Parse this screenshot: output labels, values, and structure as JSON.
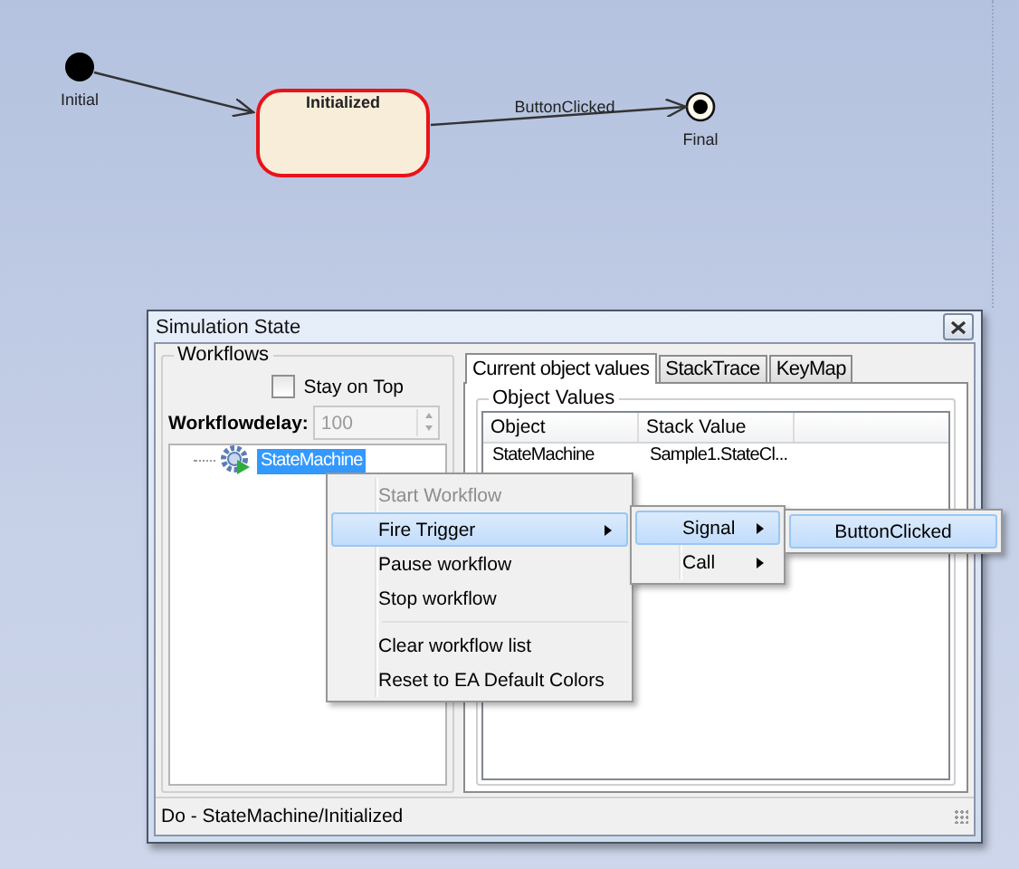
{
  "diagram": {
    "nodes": [
      {
        "kind": "initial",
        "label": "Initial"
      },
      {
        "kind": "state",
        "label": "Initialized",
        "current": true
      },
      {
        "kind": "final",
        "label": "Final"
      }
    ],
    "transitions": [
      {
        "kind": "plain"
      },
      {
        "kind": "labelled",
        "label": "ButtonClicked"
      }
    ]
  },
  "window": {
    "title": "Simulation State"
  },
  "workflows": {
    "title": "Workflows",
    "stay_on_top": {
      "label": "Stay on Top",
      "checked": false
    },
    "delay": {
      "label": "Workflowdelay:",
      "value": "100",
      "disabled": true
    },
    "tree": [
      {
        "label": "StateMachine",
        "selected": true
      }
    ]
  },
  "tabs": [
    {
      "label": "Current object values",
      "selected": true
    },
    {
      "label": "StackTrace",
      "selected": false
    },
    {
      "label": "KeyMap",
      "selected": false
    }
  ],
  "object_values": {
    "title": "Object Values",
    "columns": [
      "Object",
      "Stack Value"
    ],
    "rows": [
      [
        "StateMachine",
        "Sample1.StateCl..."
      ]
    ]
  },
  "status_bar": "Do - StateMachine/Initialized",
  "context_menu": [
    {
      "kind": "item",
      "label": "Start Workflow",
      "disabled": true,
      "selected": false,
      "submenu": false
    },
    {
      "kind": "item",
      "label": "Fire Trigger",
      "disabled": false,
      "selected": true,
      "submenu": true
    },
    {
      "kind": "item",
      "label": "Pause workflow",
      "disabled": false,
      "selected": false,
      "submenu": false
    },
    {
      "kind": "item",
      "label": "Stop workflow",
      "disabled": false,
      "selected": false,
      "submenu": false
    },
    {
      "kind": "separator"
    },
    {
      "kind": "item",
      "label": "Clear workflow list",
      "disabled": false,
      "selected": false,
      "submenu": false
    },
    {
      "kind": "item",
      "label": "Reset to EA Default Colors",
      "disabled": false,
      "selected": false,
      "submenu": false
    }
  ],
  "submenu": [
    {
      "kind": "item",
      "label": "Signal",
      "disabled": false,
      "selected": true,
      "submenu": true
    },
    {
      "kind": "item",
      "label": "Call",
      "disabled": false,
      "selected": false,
      "submenu": true
    }
  ],
  "submenu_2": [
    {
      "kind": "item",
      "label": "ButtonClicked",
      "disabled": false,
      "selected": true,
      "submenu": false
    }
  ]
}
